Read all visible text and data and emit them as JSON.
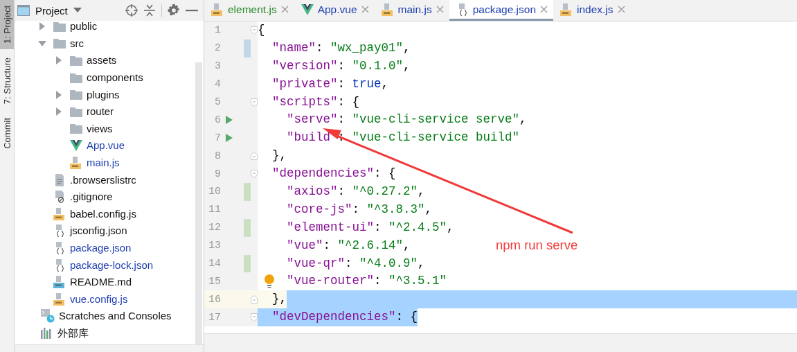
{
  "tool_strip": [
    {
      "label": "1: Project",
      "selected": true
    },
    {
      "label": "7: Structure",
      "selected": false
    },
    {
      "label": "Commit",
      "selected": false
    }
  ],
  "project_panel": {
    "title": "Project",
    "items": [
      {
        "label": "public",
        "kind": "folder",
        "expanded": false,
        "modified": false
      },
      {
        "label": "src",
        "kind": "folder",
        "expanded": true,
        "modified": false,
        "children": [
          {
            "label": "assets",
            "kind": "folder",
            "expanded": false,
            "modified": false
          },
          {
            "label": "components",
            "kind": "folder",
            "modified": false
          },
          {
            "label": "plugins",
            "kind": "folder",
            "expanded": false,
            "modified": false
          },
          {
            "label": "router",
            "kind": "folder",
            "expanded": false,
            "modified": false
          },
          {
            "label": "views",
            "kind": "folder",
            "modified": false
          },
          {
            "label": "App.vue",
            "kind": "vue",
            "modified": true
          },
          {
            "label": "main.js",
            "kind": "js",
            "modified": true
          }
        ]
      },
      {
        "label": ".browserslistrc",
        "kind": "text",
        "modified": false
      },
      {
        "label": ".gitignore",
        "kind": "ignore",
        "modified": false
      },
      {
        "label": "babel.config.js",
        "kind": "js",
        "modified": false
      },
      {
        "label": "jsconfig.json",
        "kind": "json",
        "modified": false
      },
      {
        "label": "package.json",
        "kind": "json",
        "modified": true
      },
      {
        "label": "package-lock.json",
        "kind": "json",
        "modified": true
      },
      {
        "label": "README.md",
        "kind": "md",
        "modified": false
      },
      {
        "label": "vue.config.js",
        "kind": "js",
        "modified": true
      }
    ],
    "extra_items": [
      {
        "label": "Scratches and Consoles",
        "kind": "scratches"
      },
      {
        "label": "外部库",
        "kind": "library"
      }
    ]
  },
  "tabs": [
    {
      "label": "element.js",
      "kind": "js",
      "new_file": true,
      "selected": false
    },
    {
      "label": "App.vue",
      "kind": "vue",
      "new_file": false,
      "selected": false
    },
    {
      "label": "main.js",
      "kind": "js",
      "new_file": false,
      "selected": false
    },
    {
      "label": "package.json",
      "kind": "json",
      "new_file": false,
      "selected": true
    },
    {
      "label": "index.js",
      "kind": "js",
      "new_file": false,
      "selected": false
    }
  ],
  "editor": {
    "lines": [
      {
        "number": "1",
        "fold_start": true,
        "tokens": [
          {
            "kind": "punct",
            "text": "{"
          }
        ],
        "children": [
          {
            "number": "2",
            "changed": true,
            "tokens": [
              {
                "kind": "key",
                "text": "\"name\""
              },
              {
                "kind": "punct",
                "text": ":"
              },
              {
                "kind": "string",
                "text": "\"wx_pay01\""
              },
              {
                "kind": "punct",
                "text": ","
              }
            ]
          },
          {
            "number": "3",
            "tokens": [
              {
                "kind": "key",
                "text": "\"version\""
              },
              {
                "kind": "punct",
                "text": ":"
              },
              {
                "kind": "string",
                "text": "\"0.1.0\""
              },
              {
                "kind": "punct",
                "text": ","
              }
            ]
          },
          {
            "number": "4",
            "tokens": [
              {
                "kind": "key",
                "text": "\"private\""
              },
              {
                "kind": "punct",
                "text": ":"
              },
              {
                "kind": "keyword",
                "text": "true"
              },
              {
                "kind": "punct",
                "text": ","
              }
            ]
          },
          {
            "number": "5",
            "fold_start": true,
            "tokens": [
              {
                "kind": "key",
                "text": "\"scripts\""
              },
              {
                "kind": "punct",
                "text": ":"
              },
              {
                "kind": "punct",
                "text": "{"
              }
            ],
            "children": [
              {
                "number": "6",
                "run": true,
                "tokens": [
                  {
                    "kind": "key",
                    "text": "\"serve\""
                  },
                  {
                    "kind": "punct",
                    "text": ":"
                  },
                  {
                    "kind": "string",
                    "text": "\"vue-cli-service serve\""
                  },
                  {
                    "kind": "punct",
                    "text": ","
                  }
                ]
              },
              {
                "number": "7",
                "run": true,
                "tokens": [
                  {
                    "kind": "key",
                    "text": "\"build"
                  },
                  {
                    "kind": "covered"
                  },
                  {
                    "kind": "punct",
                    "text": ":"
                  },
                  {
                    "kind": "string",
                    "text": "\"vue-cli-service build\""
                  }
                ]
              }
            ]
          },
          {
            "number": "8",
            "fold_end": true,
            "tokens": [
              {
                "kind": "punct",
                "text": "},"
              }
            ]
          },
          {
            "number": "9",
            "fold_start": true,
            "tokens": [
              {
                "kind": "key",
                "text": "\"dependencies\""
              },
              {
                "kind": "punct",
                "text": ":"
              },
              {
                "kind": "punct",
                "text": "{"
              }
            ],
            "children": [
              {
                "number": "10",
                "added": true,
                "tokens": [
                  {
                    "kind": "key",
                    "text": "\"axios\""
                  },
                  {
                    "kind": "punct",
                    "text": ":"
                  },
                  {
                    "kind": "string",
                    "text": "\"^0.27.2\""
                  },
                  {
                    "kind": "punct",
                    "text": ","
                  }
                ]
              },
              {
                "number": "11",
                "tokens": [
                  {
                    "kind": "key",
                    "text": "\"core-js\""
                  },
                  {
                    "kind": "punct",
                    "text": ":"
                  },
                  {
                    "kind": "string",
                    "text": "\"^3.8.3\""
                  },
                  {
                    "kind": "punct",
                    "text": ","
                  }
                ]
              },
              {
                "number": "12",
                "added": true,
                "tokens": [
                  {
                    "kind": "key",
                    "text": "\"element-ui\""
                  },
                  {
                    "kind": "punct",
                    "text": ":"
                  },
                  {
                    "kind": "string",
                    "text": "\"^2.4.5\""
                  },
                  {
                    "kind": "punct",
                    "text": ","
                  }
                ]
              },
              {
                "number": "13",
                "tokens": [
                  {
                    "kind": "key",
                    "text": "\"vue\""
                  },
                  {
                    "kind": "punct",
                    "text": ":"
                  },
                  {
                    "kind": "string",
                    "text": "\"^2.6.14\""
                  },
                  {
                    "kind": "punct",
                    "text": ","
                  }
                ]
              },
              {
                "number": "14",
                "added": true,
                "tokens": [
                  {
                    "kind": "key",
                    "text": "\"vue-qr\""
                  },
                  {
                    "kind": "punct",
                    "text": ":"
                  },
                  {
                    "kind": "string",
                    "text": "\"^4.0.9\""
                  },
                  {
                    "kind": "punct",
                    "text": ","
                  }
                ]
              },
              {
                "number": "15",
                "bulb": true,
                "tokens": [
                  {
                    "kind": "key",
                    "text": "\"vue-router\""
                  },
                  {
                    "kind": "punct",
                    "text": ":"
                  },
                  {
                    "kind": "string",
                    "text": "\"^3.5.1\""
                  }
                ]
              }
            ]
          },
          {
            "number": "16",
            "fold_end": true,
            "current": true,
            "selected_after": true,
            "tokens": [
              {
                "kind": "punct",
                "text": "},"
              }
            ]
          },
          {
            "number": "17",
            "fold_start": true,
            "selected": true,
            "tokens": [
              {
                "kind": "key",
                "text": "\"devDependencies\""
              },
              {
                "kind": "punct",
                "text": ":"
              },
              {
                "kind": "punct",
                "text": "{"
              }
            ]
          }
        ]
      }
    ]
  },
  "annotation": {
    "text": "npm run serve"
  }
}
